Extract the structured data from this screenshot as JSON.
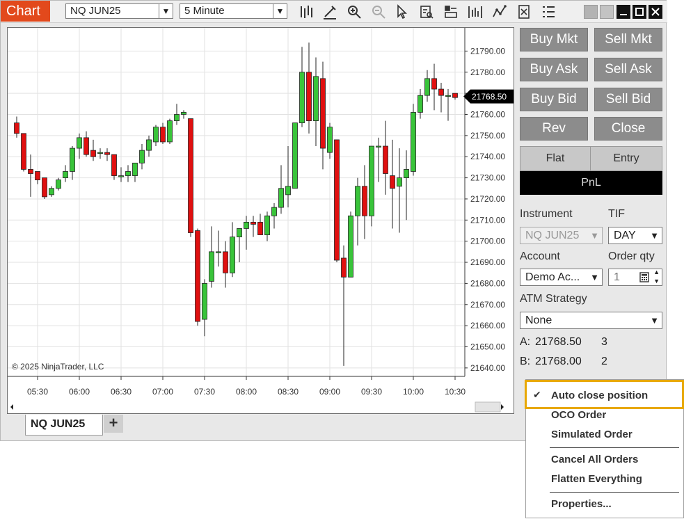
{
  "app": {
    "title": "Chart"
  },
  "toolbar": {
    "instrument": "NQ JUN25",
    "interval": "5 Minute",
    "icons": [
      "bar-type-icon",
      "draw-pencil-icon",
      "zoom-in-icon",
      "zoom-out-icon",
      "pointer-icon",
      "data-box-icon",
      "panel-icon",
      "strategy-icon",
      "indicator-icon",
      "price-marker-icon",
      "properties-list-icon"
    ]
  },
  "window_controls": [
    "minimize-icon",
    "maximize-icon",
    "close-icon"
  ],
  "chart": {
    "watermark": "© 2025 NinjaTrader, LLC",
    "y_ticks": [
      "21790.00",
      "21780.00",
      "21770.00",
      "21760.00",
      "21750.00",
      "21740.00",
      "21730.00",
      "21720.00",
      "21710.00",
      "21700.00",
      "21690.00",
      "21680.00",
      "21670.00",
      "21660.00",
      "21650.00",
      "21640.00"
    ],
    "x_ticks": [
      "05:30",
      "06:00",
      "06:30",
      "07:00",
      "07:30",
      "08:00",
      "08:30",
      "09:00",
      "09:30",
      "10:00",
      "10:30"
    ],
    "last_price": "21768.50",
    "colors": {
      "up": "#39c43a",
      "down": "#e01010",
      "grid": "#e2e2e2",
      "last_price_bg": "#000000"
    }
  },
  "chart_data": {
    "type": "candlestick",
    "title": "",
    "instrument": "NQ JUN25",
    "interval": "5 Minute",
    "ylim": [
      21636,
      21801
    ],
    "candles": [
      {
        "t": "05:15",
        "o": 21756,
        "h": 21759,
        "l": 21749,
        "c": 21751
      },
      {
        "t": "05:20",
        "o": 21751,
        "h": 21751,
        "l": 21733,
        "c": 21734
      },
      {
        "t": "05:25",
        "o": 21734,
        "h": 21741,
        "l": 21721,
        "c": 21732
      },
      {
        "t": "05:30",
        "o": 21733,
        "h": 21733,
        "l": 21727,
        "c": 21729
      },
      {
        "t": "05:35",
        "o": 21730,
        "h": 21730,
        "l": 21720,
        "c": 21721
      },
      {
        "t": "05:40",
        "o": 21722,
        "h": 21726,
        "l": 21721,
        "c": 21725
      },
      {
        "t": "05:45",
        "o": 21725,
        "h": 21730,
        "l": 21724,
        "c": 21729
      },
      {
        "t": "05:50",
        "o": 21730,
        "h": 21736,
        "l": 21728,
        "c": 21733
      },
      {
        "t": "05:55",
        "o": 21733,
        "h": 21745,
        "l": 21729,
        "c": 21744
      },
      {
        "t": "06:00",
        "o": 21744,
        "h": 21751,
        "l": 21739,
        "c": 21749
      },
      {
        "t": "06:05",
        "o": 21749,
        "h": 21752,
        "l": 21740,
        "c": 21741
      },
      {
        "t": "06:10",
        "o": 21743,
        "h": 21748,
        "l": 21738,
        "c": 21740
      },
      {
        "t": "06:15",
        "o": 21742,
        "h": 21744,
        "l": 21739,
        "c": 21742
      },
      {
        "t": "06:20",
        "o": 21742,
        "h": 21744,
        "l": 21738,
        "c": 21741
      },
      {
        "t": "06:25",
        "o": 21741,
        "h": 21741,
        "l": 21729,
        "c": 21731
      },
      {
        "t": "06:30",
        "o": 21731,
        "h": 21735,
        "l": 21728,
        "c": 21731
      },
      {
        "t": "06:35",
        "o": 21731,
        "h": 21736,
        "l": 21728,
        "c": 21733
      },
      {
        "t": "06:40",
        "o": 21731,
        "h": 21737,
        "l": 21728,
        "c": 21737
      },
      {
        "t": "06:45",
        "o": 21737,
        "h": 21746,
        "l": 21734,
        "c": 21743
      },
      {
        "t": "06:50",
        "o": 21743,
        "h": 21750,
        "l": 21740,
        "c": 21748
      },
      {
        "t": "06:55",
        "o": 21747,
        "h": 21755,
        "l": 21745,
        "c": 21754
      },
      {
        "t": "07:00",
        "o": 21754,
        "h": 21756,
        "l": 21746,
        "c": 21747
      },
      {
        "t": "07:05",
        "o": 21747,
        "h": 21758,
        "l": 21746,
        "c": 21757
      },
      {
        "t": "07:10",
        "o": 21757,
        "h": 21765,
        "l": 21755,
        "c": 21760
      },
      {
        "t": "07:15",
        "o": 21760,
        "h": 21762,
        "l": 21758,
        "c": 21761
      },
      {
        "t": "07:20",
        "o": 21758,
        "h": 21758,
        "l": 21702,
        "c": 21704
      },
      {
        "t": "07:25",
        "o": 21705,
        "h": 21706,
        "l": 21660,
        "c": 21662
      },
      {
        "t": "07:30",
        "o": 21663,
        "h": 21682,
        "l": 21655,
        "c": 21680
      },
      {
        "t": "07:35",
        "o": 21681,
        "h": 21707,
        "l": 21678,
        "c": 21695
      },
      {
        "t": "07:40",
        "o": 21695,
        "h": 21705,
        "l": 21688,
        "c": 21695
      },
      {
        "t": "07:45",
        "o": 21695,
        "h": 21700,
        "l": 21678,
        "c": 21685
      },
      {
        "t": "07:50",
        "o": 21685,
        "h": 21709,
        "l": 21683,
        "c": 21702
      },
      {
        "t": "07:55",
        "o": 21702,
        "h": 21706,
        "l": 21690,
        "c": 21706
      },
      {
        "t": "08:00",
        "o": 21706,
        "h": 21712,
        "l": 21696,
        "c": 21709
      },
      {
        "t": "08:05",
        "o": 21709,
        "h": 21712,
        "l": 21702,
        "c": 21708
      },
      {
        "t": "08:10",
        "o": 21709,
        "h": 21713,
        "l": 21703,
        "c": 21703
      },
      {
        "t": "08:15",
        "o": 21703,
        "h": 21714,
        "l": 21700,
        "c": 21712
      },
      {
        "t": "08:20",
        "o": 21712,
        "h": 21718,
        "l": 21706,
        "c": 21716
      },
      {
        "t": "08:25",
        "o": 21716,
        "h": 21736,
        "l": 21713,
        "c": 21725
      },
      {
        "t": "08:30",
        "o": 21722,
        "h": 21745,
        "l": 21716,
        "c": 21726
      },
      {
        "t": "08:35",
        "o": 21725,
        "h": 21756,
        "l": 21725,
        "c": 21756
      },
      {
        "t": "08:40",
        "o": 21756,
        "h": 21792,
        "l": 21754,
        "c": 21780
      },
      {
        "t": "08:45",
        "o": 21780,
        "h": 21794,
        "l": 21751,
        "c": 21757
      },
      {
        "t": "08:50",
        "o": 21757,
        "h": 21787,
        "l": 21745,
        "c": 21778
      },
      {
        "t": "08:55",
        "o": 21777,
        "h": 21785,
        "l": 21734,
        "c": 21744
      },
      {
        "t": "09:00",
        "o": 21742,
        "h": 21756,
        "l": 21739,
        "c": 21754
      },
      {
        "t": "09:05",
        "o": 21748,
        "h": 21748,
        "l": 21690,
        "c": 21691
      },
      {
        "t": "09:10",
        "o": 21692,
        "h": 21698,
        "l": 21641,
        "c": 21683
      },
      {
        "t": "09:15",
        "o": 21683,
        "h": 21714,
        "l": 21683,
        "c": 21712
      },
      {
        "t": "09:20",
        "o": 21712,
        "h": 21730,
        "l": 21698,
        "c": 21726
      },
      {
        "t": "09:25",
        "o": 21726,
        "h": 21736,
        "l": 21701,
        "c": 21712
      },
      {
        "t": "09:30",
        "o": 21712,
        "h": 21745,
        "l": 21707,
        "c": 21745
      },
      {
        "t": "09:35",
        "o": 21745,
        "h": 21749,
        "l": 21728,
        "c": 21745
      },
      {
        "t": "09:40",
        "o": 21745,
        "h": 21757,
        "l": 21722,
        "c": 21732
      },
      {
        "t": "09:45",
        "o": 21731,
        "h": 21748,
        "l": 21706,
        "c": 21725
      },
      {
        "t": "09:50",
        "o": 21726,
        "h": 21744,
        "l": 21704,
        "c": 21730
      },
      {
        "t": "09:55",
        "o": 21730,
        "h": 21743,
        "l": 21710,
        "c": 21734
      },
      {
        "t": "10:00",
        "o": 21733,
        "h": 21765,
        "l": 21731,
        "c": 21761
      },
      {
        "t": "10:05",
        "o": 21761,
        "h": 21772,
        "l": 21758,
        "c": 21769
      },
      {
        "t": "10:10",
        "o": 21769,
        "h": 21781,
        "l": 21766,
        "c": 21777
      },
      {
        "t": "10:15",
        "o": 21777,
        "h": 21784,
        "l": 21762,
        "c": 21772
      },
      {
        "t": "10:20",
        "o": 21772,
        "h": 21775,
        "l": 21761,
        "c": 21769
      },
      {
        "t": "10:25",
        "o": 21769,
        "h": 21772,
        "l": 21757,
        "c": 21769
      },
      {
        "t": "10:30",
        "o": 21770,
        "h": 21770,
        "l": 21767,
        "c": 21768
      }
    ]
  },
  "tabs": {
    "active": "NQ JUN25",
    "add": "+"
  },
  "order_panel": {
    "buy_mkt": "Buy Mkt",
    "sell_mkt": "Sell Mkt",
    "buy_ask": "Buy Ask",
    "sell_ask": "Sell Ask",
    "buy_bid": "Buy Bid",
    "sell_bid": "Sell Bid",
    "rev": "Rev",
    "close": "Close",
    "flat": "Flat",
    "entry": "Entry",
    "pnl": "PnL",
    "instrument_label": "Instrument",
    "instrument_value": "NQ JUN25",
    "tif_label": "TIF",
    "tif_value": "DAY",
    "account_label": "Account",
    "account_value": "Demo Ac...",
    "order_qty_label": "Order qty",
    "order_qty_value": "1",
    "atm_label": "ATM Strategy",
    "atm_value": "None",
    "ask_label": "A:",
    "ask_price": "21768.50",
    "ask_size": "3",
    "bid_label": "B:",
    "bid_price": "21768.00",
    "bid_size": "2"
  },
  "context_menu": {
    "check": "✔",
    "items": [
      "Auto close position",
      "OCO Order",
      "Simulated Order",
      "Cancel All Orders",
      "Flatten Everything",
      "Properties..."
    ],
    "highlight_color": "#e8a800"
  }
}
